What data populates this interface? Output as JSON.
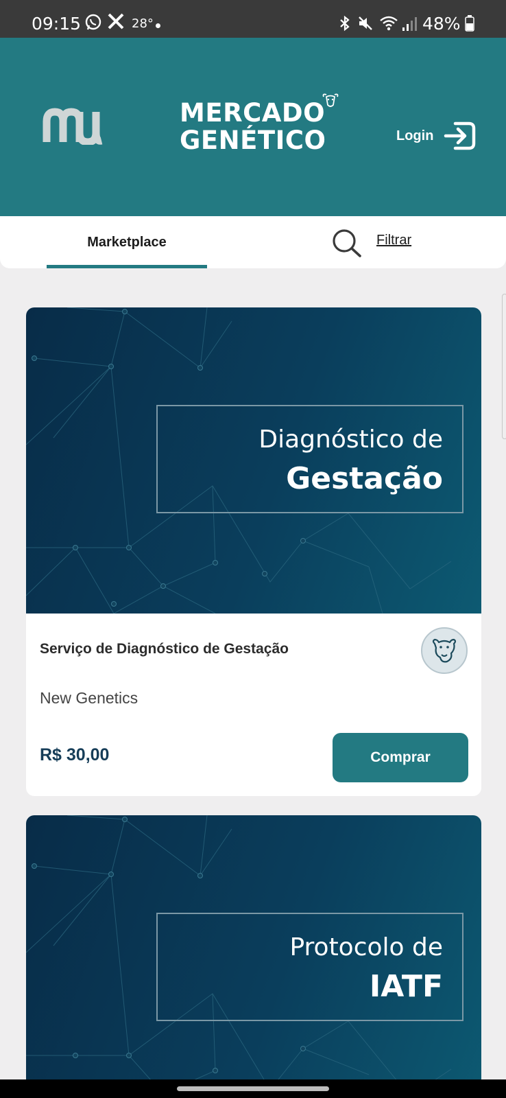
{
  "status_bar": {
    "time": "09:15",
    "temperature": "28°",
    "battery": "48%",
    "icons": [
      "whatsapp-icon",
      "x-icon",
      "bluetooth-icon",
      "mute-icon",
      "wifi-icon",
      "signal-icon",
      "battery-icon"
    ]
  },
  "header": {
    "logo_icon": "mw-logo",
    "brand_line1": "MERCADO",
    "brand_line2": "GENÉTICO",
    "login_label": "Login",
    "login_icon": "login-arrow-icon"
  },
  "tabs": {
    "marketplace_label": "Marketplace",
    "filter_label": "Filtrar",
    "search_icon": "search-icon"
  },
  "products": [
    {
      "banner_line1": "Diagnóstico de",
      "banner_line2": "Gestação",
      "title": "Serviço de Diagnóstico de Gestação",
      "seller": "New Genetics",
      "price": "R$ 30,00",
      "buy_label": "Comprar"
    },
    {
      "banner_line1": "Protocolo de",
      "banner_line2": "IATF"
    }
  ],
  "colors": {
    "header_teal": "#237a82",
    "price_navy": "#163d58",
    "banner_dark": "#082c48",
    "background": "#efeeef"
  }
}
